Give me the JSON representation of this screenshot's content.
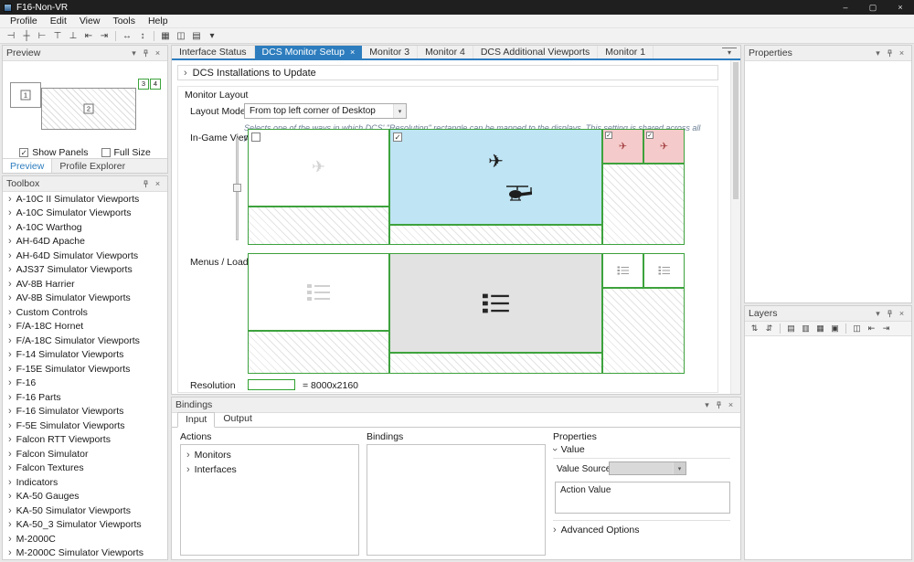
{
  "colors": {
    "accent_blue": "#2d7dbe",
    "titlebar": "#1f1f1f",
    "monitor_border": "#3da23d",
    "selected_monitor_fill": "#bfe4f3",
    "small_monitor_fill": "#f5caca",
    "resolution_border": "#2ca02c"
  },
  "icons": {
    "chevron_right": "›",
    "chevron_down": "▾",
    "close": "×",
    "minimize": "–",
    "maximize": "▢",
    "check": "✓",
    "plane": "✈",
    "tab_list": "▾"
  },
  "window": {
    "title": "F16-Non-VR"
  },
  "menu_bar": {
    "items": [
      "Profile",
      "Edit",
      "View",
      "Tools",
      "Help"
    ]
  },
  "main_toolbar": {
    "icons": [
      "⊣",
      "┼",
      "⊢",
      "⊤",
      "⊥",
      "⇤",
      "⇥",
      "↔",
      "↕",
      "▦",
      "◫",
      "▤",
      "▾"
    ]
  },
  "preview": {
    "title": "Preview",
    "monitors": [
      {
        "label": "1"
      },
      {
        "label": "2"
      },
      {
        "label": "3"
      },
      {
        "label": "4"
      }
    ],
    "show_panels": {
      "label": "Show Panels",
      "checked": true,
      "mark": "✓"
    },
    "full_size": {
      "label": "Full Size",
      "checked": false,
      "mark": ""
    },
    "tabs": [
      {
        "label": "Preview",
        "active": true
      },
      {
        "label": "Profile Explorer",
        "active": false
      }
    ]
  },
  "toolbox": {
    "title": "Toolbox",
    "items": [
      "A-10C II Simulator Viewports",
      "A-10C Simulator Viewports",
      "A-10C Warthog",
      "AH-64D Apache",
      "AH-64D Simulator Viewports",
      "AJS37 Simulator Viewports",
      "AV-8B Harrier",
      "AV-8B Simulator Viewports",
      "Custom Controls",
      "F/A-18C Hornet",
      "F/A-18C Simulator Viewports",
      "F-14 Simulator Viewports",
      "F-15E Simulator Viewports",
      "F-16",
      "F-16 Parts",
      "F-16 Simulator Viewports",
      "F-5E Simulator Viewports",
      "Falcon RTT Viewports",
      "Falcon Simulator",
      "Falcon Textures",
      "Indicators",
      "KA-50 Gauges",
      "KA-50 Simulator Viewports",
      "KA-50_3 Simulator Viewports",
      "M-2000C",
      "M-2000C Simulator Viewports"
    ]
  },
  "document": {
    "tabs": [
      {
        "label": "Interface Status",
        "active": false
      },
      {
        "label": "DCS Monitor Setup",
        "active": true
      },
      {
        "label": "Monitor 3",
        "active": false
      },
      {
        "label": "Monitor 4",
        "active": false
      },
      {
        "label": "DCS Additional Viewports",
        "active": false
      },
      {
        "label": "Monitor 1",
        "active": false
      }
    ],
    "installations_expander_label": "DCS Installations to Update",
    "monitor_layout": {
      "section_title": "Monitor Layout",
      "layout_mode": {
        "label": "Layout Mode",
        "value": "From top left corner of Desktop"
      },
      "hint": "Selects one of the ways in which DCS' \"Resolution\" rectangle can be mapped to the displays. This setting is shared across all profiles on this computer.",
      "in_game_view": {
        "label": "In-Game View",
        "monitors": [
          {
            "name": "left",
            "selected": false,
            "mark": ""
          },
          {
            "name": "center",
            "selected": true,
            "mark": "✓"
          },
          {
            "name": "right-top-1",
            "selected": true,
            "mark": "✓"
          },
          {
            "name": "right-top-2",
            "selected": true,
            "mark": "✓"
          }
        ]
      },
      "menus_loading": {
        "label": "Menus / Loading"
      },
      "resolution": {
        "label": "Resolution",
        "value": "= 8000x2160"
      }
    }
  },
  "bindings": {
    "title": "Bindings",
    "tabs": [
      {
        "label": "Input",
        "active": true
      },
      {
        "label": "Output",
        "active": false
      }
    ],
    "columns": {
      "actions": "Actions",
      "bindings": "Bindings",
      "properties": "Properties"
    },
    "actions_tree": [
      "Monitors",
      "Interfaces"
    ],
    "value_section": {
      "label": "Value",
      "value_source_label": "Value Source",
      "value_source_value": "",
      "action_value_label": "Action Value",
      "advanced_label": "Advanced Options"
    }
  },
  "properties_panel": {
    "title": "Properties"
  },
  "layers_panel": {
    "title": "Layers",
    "toolbar_icons": [
      "⇅",
      "⇵",
      "▤",
      "▥",
      "▦",
      "▣",
      "◫",
      "⇤",
      "⇥"
    ]
  }
}
